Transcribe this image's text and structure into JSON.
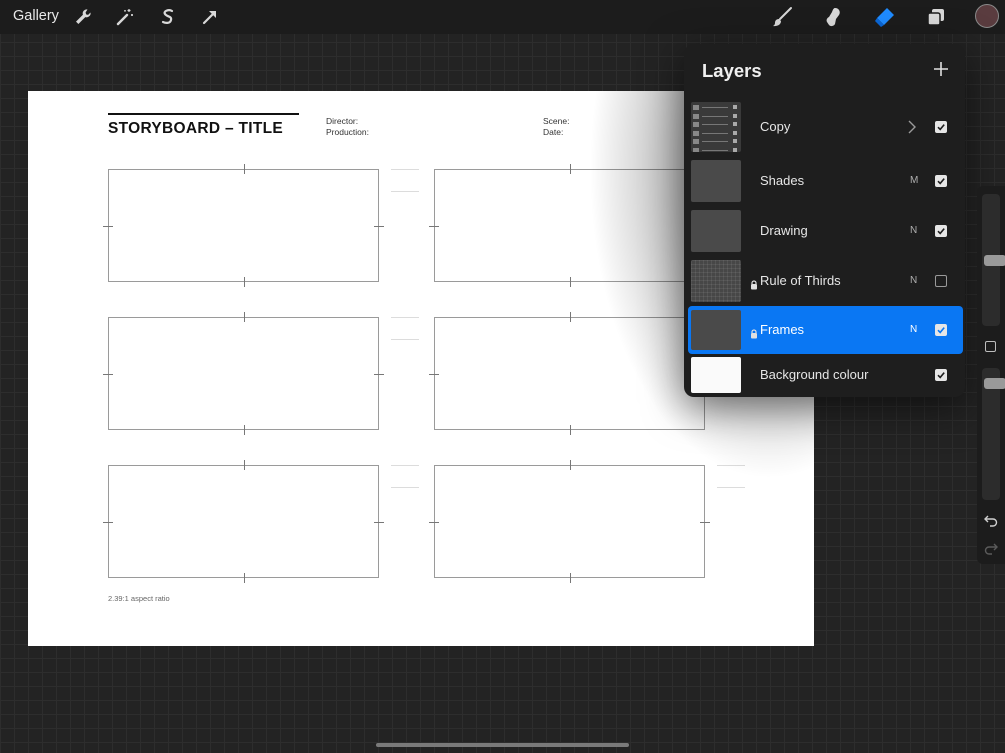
{
  "toolbar": {
    "gallery_label": "Gallery",
    "left_icons": [
      "wrench-icon",
      "magic-wand-icon",
      "selection-icon",
      "transform-arrow-icon"
    ],
    "right_icons": [
      "brush-icon",
      "smudge-icon",
      "eraser-icon",
      "layers-icon",
      "color-swatch"
    ],
    "active_tool": "eraser",
    "accent_color": "#0a77f3",
    "swatch_color": "#5a3c3f"
  },
  "canvas": {
    "title": "STORYBOARD – TITLE",
    "director_label": "Director:",
    "production_label": "Production:",
    "scene_label": "Scene:",
    "date_label": "Date:",
    "aspect_note": "2.39:1 aspect ratio",
    "frame_rows": 3,
    "frame_cols": 2
  },
  "layers": {
    "title": "Layers",
    "add_label": "+",
    "items": [
      {
        "name": "Copy",
        "blend": "",
        "visible": true,
        "locked": false,
        "selected": false,
        "is_group": true,
        "thumb": "group"
      },
      {
        "name": "Shades",
        "blend": "M",
        "visible": true,
        "locked": false,
        "selected": false,
        "is_group": false,
        "thumb": "dark"
      },
      {
        "name": "Drawing",
        "blend": "N",
        "visible": true,
        "locked": false,
        "selected": false,
        "is_group": false,
        "thumb": "dark"
      },
      {
        "name": "Rule of Thirds",
        "blend": "N",
        "visible": false,
        "locked": true,
        "selected": false,
        "is_group": false,
        "thumb": "grid"
      },
      {
        "name": "Frames",
        "blend": "N",
        "visible": true,
        "locked": true,
        "selected": true,
        "is_group": false,
        "thumb": "dark"
      },
      {
        "name": "Background colour",
        "blend": "",
        "visible": true,
        "locked": false,
        "selected": false,
        "is_group": false,
        "thumb": "white"
      }
    ]
  },
  "side_controls": {
    "brush_size": 0.25,
    "opacity": 0.6,
    "icons": [
      "modify-square-icon",
      "undo-icon",
      "redo-icon"
    ]
  }
}
